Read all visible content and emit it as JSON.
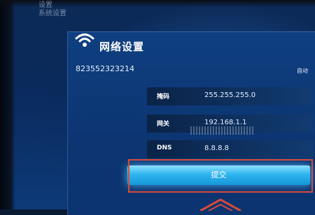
{
  "breadcrumb": {
    "line1": "设置",
    "line2": "系统设置"
  },
  "panel": {
    "title": "网络设置",
    "icon": "wifi-icon",
    "device_id": "823552323214",
    "mode_label": "自动"
  },
  "fields": [
    {
      "label": "掩码",
      "value": "255.255.255.0"
    },
    {
      "label": "网关",
      "value": "192.168.1.1"
    },
    {
      "label": "DNS",
      "value": "8.8.8.8"
    }
  ],
  "submit": {
    "label": "提交"
  },
  "colors": {
    "panel": "#0c3572",
    "button": "#2fb6f0",
    "highlight": "#d84a3a"
  }
}
